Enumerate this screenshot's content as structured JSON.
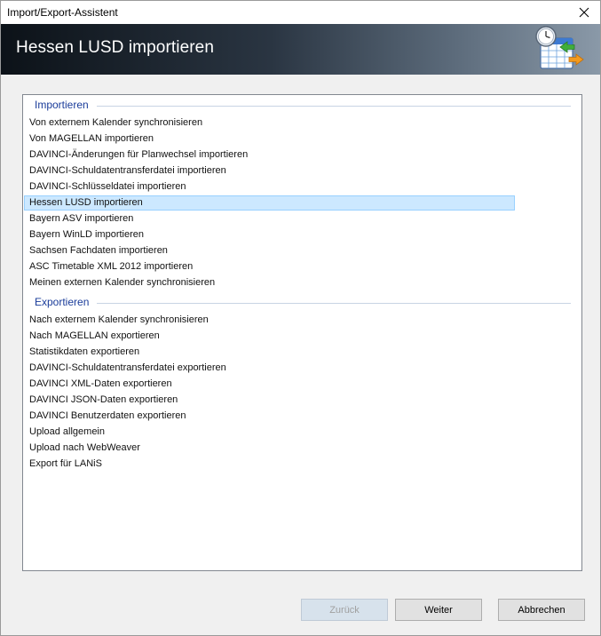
{
  "window": {
    "title": "Import/Export-Assistent"
  },
  "header": {
    "title": "Hessen LUSD importieren"
  },
  "sections": [
    {
      "title": "Importieren",
      "items": [
        {
          "label": "Von externem Kalender synchronisieren"
        },
        {
          "label": "Von MAGELLAN importieren"
        },
        {
          "label": "DAVINCI-Änderungen für Planwechsel importieren"
        },
        {
          "label": "DAVINCI-Schuldatentransferdatei importieren"
        },
        {
          "label": "DAVINCI-Schlüsseldatei importieren"
        },
        {
          "label": "Hessen LUSD importieren",
          "selected": true
        },
        {
          "label": "Bayern ASV importieren"
        },
        {
          "label": "Bayern WinLD importieren"
        },
        {
          "label": "Sachsen Fachdaten importieren"
        },
        {
          "label": "ASC Timetable XML 2012 importieren"
        },
        {
          "label": "Meinen externen Kalender synchronisieren"
        }
      ]
    },
    {
      "title": "Exportieren",
      "items": [
        {
          "label": "Nach externem Kalender synchronisieren"
        },
        {
          "label": "Nach MAGELLAN exportieren"
        },
        {
          "label": "Statistikdaten exportieren"
        },
        {
          "label": "DAVINCI-Schuldatentransferdatei exportieren"
        },
        {
          "label": "DAVINCI XML-Daten exportieren"
        },
        {
          "label": "DAVINCI JSON-Daten exportieren"
        },
        {
          "label": "DAVINCI Benutzerdaten exportieren"
        },
        {
          "label": "Upload allgemein"
        },
        {
          "label": "Upload nach WebWeaver"
        },
        {
          "label": "Export für LANiS"
        }
      ]
    }
  ],
  "buttons": {
    "back": {
      "label": "Zurück",
      "enabled": false
    },
    "next": {
      "label": "Weiter",
      "enabled": true
    },
    "cancel": {
      "label": "Abbrechen",
      "enabled": true
    }
  },
  "icons": {
    "close": "close-icon",
    "header": "calendar-clock-import-icon"
  },
  "colors": {
    "section_title": "#1a3c9a",
    "selection_bg": "#cce8ff",
    "selection_border": "#99d1ff"
  }
}
